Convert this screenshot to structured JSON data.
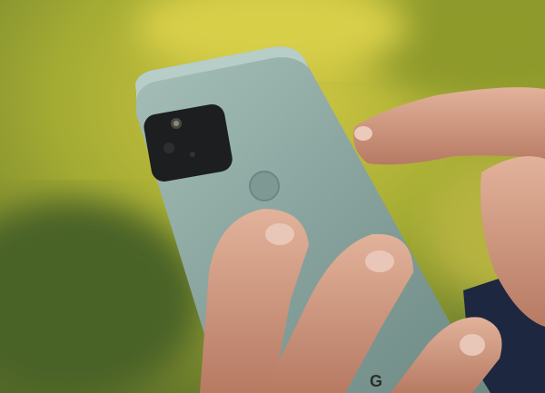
{
  "photo": {
    "subject": "phone",
    "logo_text": "G",
    "colors": {
      "background_green": "#8a9a2e",
      "background_yellow": "#c8c23a",
      "phone_body": "#8aa59f",
      "phone_edge": "#a9c0ba",
      "camera_module": "#1c1e1f",
      "skin": "#d9a48a",
      "skin_shadow": "#a86a55",
      "sleeve": "#1d2740"
    }
  }
}
